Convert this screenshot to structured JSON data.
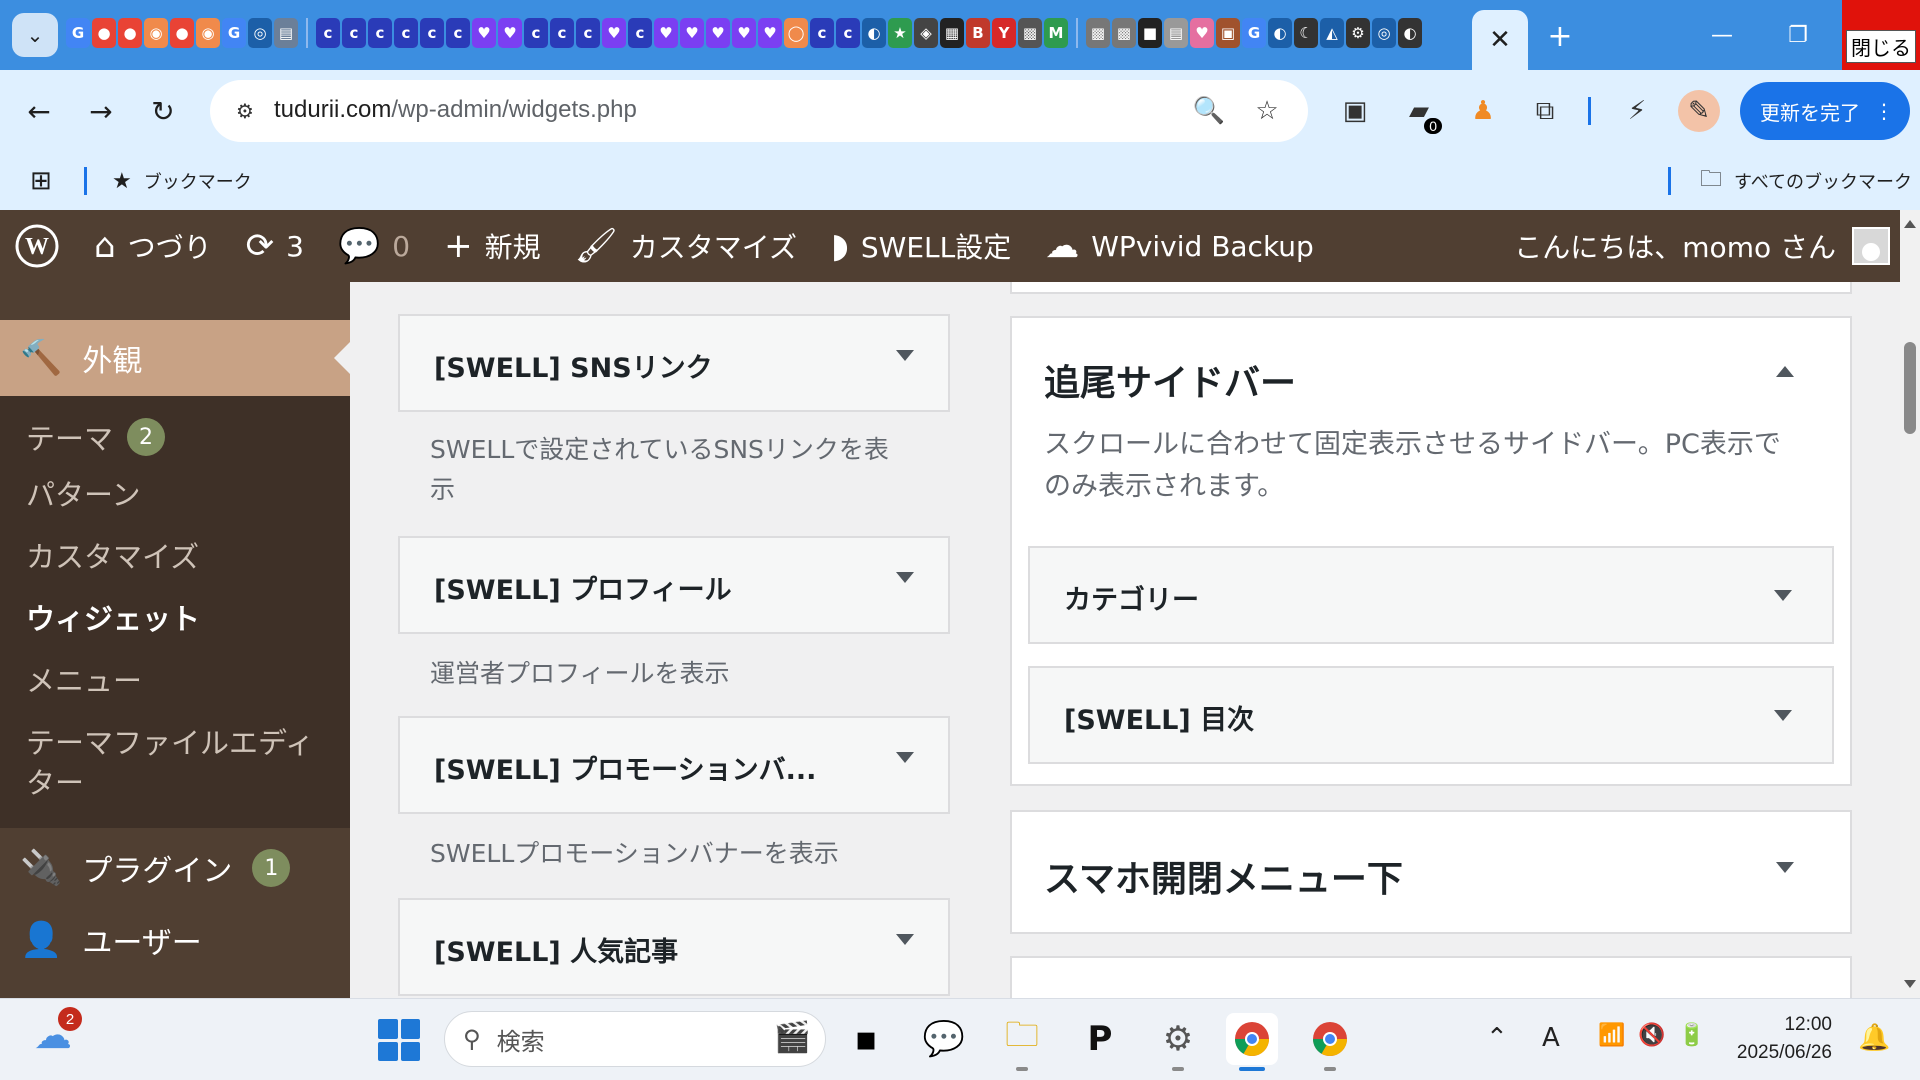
{
  "browser": {
    "close_label": "閉じる",
    "url_host": "tudurii.com",
    "url_path": "/wp-admin/widgets.php",
    "update_button": "更新を完了",
    "extension_badge": "0",
    "bookmark_item": "ブックマーク",
    "all_bookmarks": "すべてのブックマーク"
  },
  "adminbar": {
    "site": "つづり",
    "updates_count": "3",
    "comments_count": "0",
    "new": "新規",
    "customize": "カスタマイズ",
    "swell": "SWELL設定",
    "backup": "WPvivid Backup",
    "greeting": "こんにちは、momo さん"
  },
  "sidebar": {
    "active_menu": "外観",
    "submenu": [
      {
        "label": "テーマ",
        "count": "2"
      },
      {
        "label": "パターン"
      },
      {
        "label": "カスタマイズ"
      },
      {
        "label": "ウィジェット"
      },
      {
        "label": "メニュー"
      },
      {
        "label": "テーマファイルエディ"
      },
      {
        "label": "ター"
      }
    ],
    "plugins": "プラグイン",
    "plugins_count": "1",
    "users": "ユーザー"
  },
  "widgets": [
    {
      "title": "[SWELL] SNSリンク",
      "desc_1": "SWELLで設定されているSNSリンクを表",
      "desc_2": "示"
    },
    {
      "title": "[SWELL] プロフィール",
      "desc_1": "運営者プロフィールを表示"
    },
    {
      "title": "[SWELL] プロモーションバ...",
      "desc_1": "SWELLプロモーションバナーを表示"
    },
    {
      "title": "[SWELL] 人気記事"
    }
  ],
  "areas": {
    "tracking": {
      "title": "追尾サイドバー",
      "desc_1": "スクロールに合わせて固定表示させるサイドバー。PC表示で",
      "desc_2": "のみ表示されます。",
      "widgets": [
        "カテゴリー",
        "[SWELL] 目次"
      ]
    },
    "mobile_menu": {
      "title": "スマホ開閉メニュー下"
    }
  },
  "taskbar": {
    "search_placeholder": "検索",
    "weather_badge": "2",
    "time": "12:00",
    "date": "2025/06/26"
  },
  "colors": {
    "admin_bar": "#503f32",
    "sidebar_active": "#c8a285",
    "count_badge": "#7e8d5e",
    "browser_accent": "#3c8ee0"
  }
}
